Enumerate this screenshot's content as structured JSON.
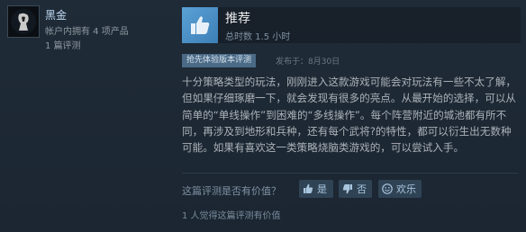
{
  "author": {
    "name": "黑金",
    "products": "帐户内拥有 4 项产品",
    "reviews": "1 篇评测",
    "avatar_icon": "silhouette-avatar-icon"
  },
  "review": {
    "verdict": "推荐",
    "verdict_icon": "thumbs-up-icon",
    "hours": "总时数 1.5 小时",
    "early_access_badge": "抢先体验版本评测",
    "posted": "发布于：8月30日",
    "text": "十分策略类型的玩法，刚刚进入这款游戏可能会对玩法有一些不太了解，但如果仔细琢磨一下，就会发现有很多的亮点。从最开始的选择，可以从简单的“单线操作”到困难的“多线操作”。每个阵营附近的城池都有所不同，再涉及到地形和兵种，还有每个武将?的特性，都可以衍生出无数种可能。如果有喜欢这一类策略烧脑类游戏的，可以尝试入手。"
  },
  "helpful": {
    "question": "这篇评测是否有价值？",
    "yes_label": "是",
    "no_label": "否",
    "funny_label": "欢乐",
    "count_text": "1 人觉得这篇评测有价值"
  },
  "colors": {
    "background": "#1b2838",
    "accent": "#5ba1d6",
    "badge": "#4a6a86"
  }
}
